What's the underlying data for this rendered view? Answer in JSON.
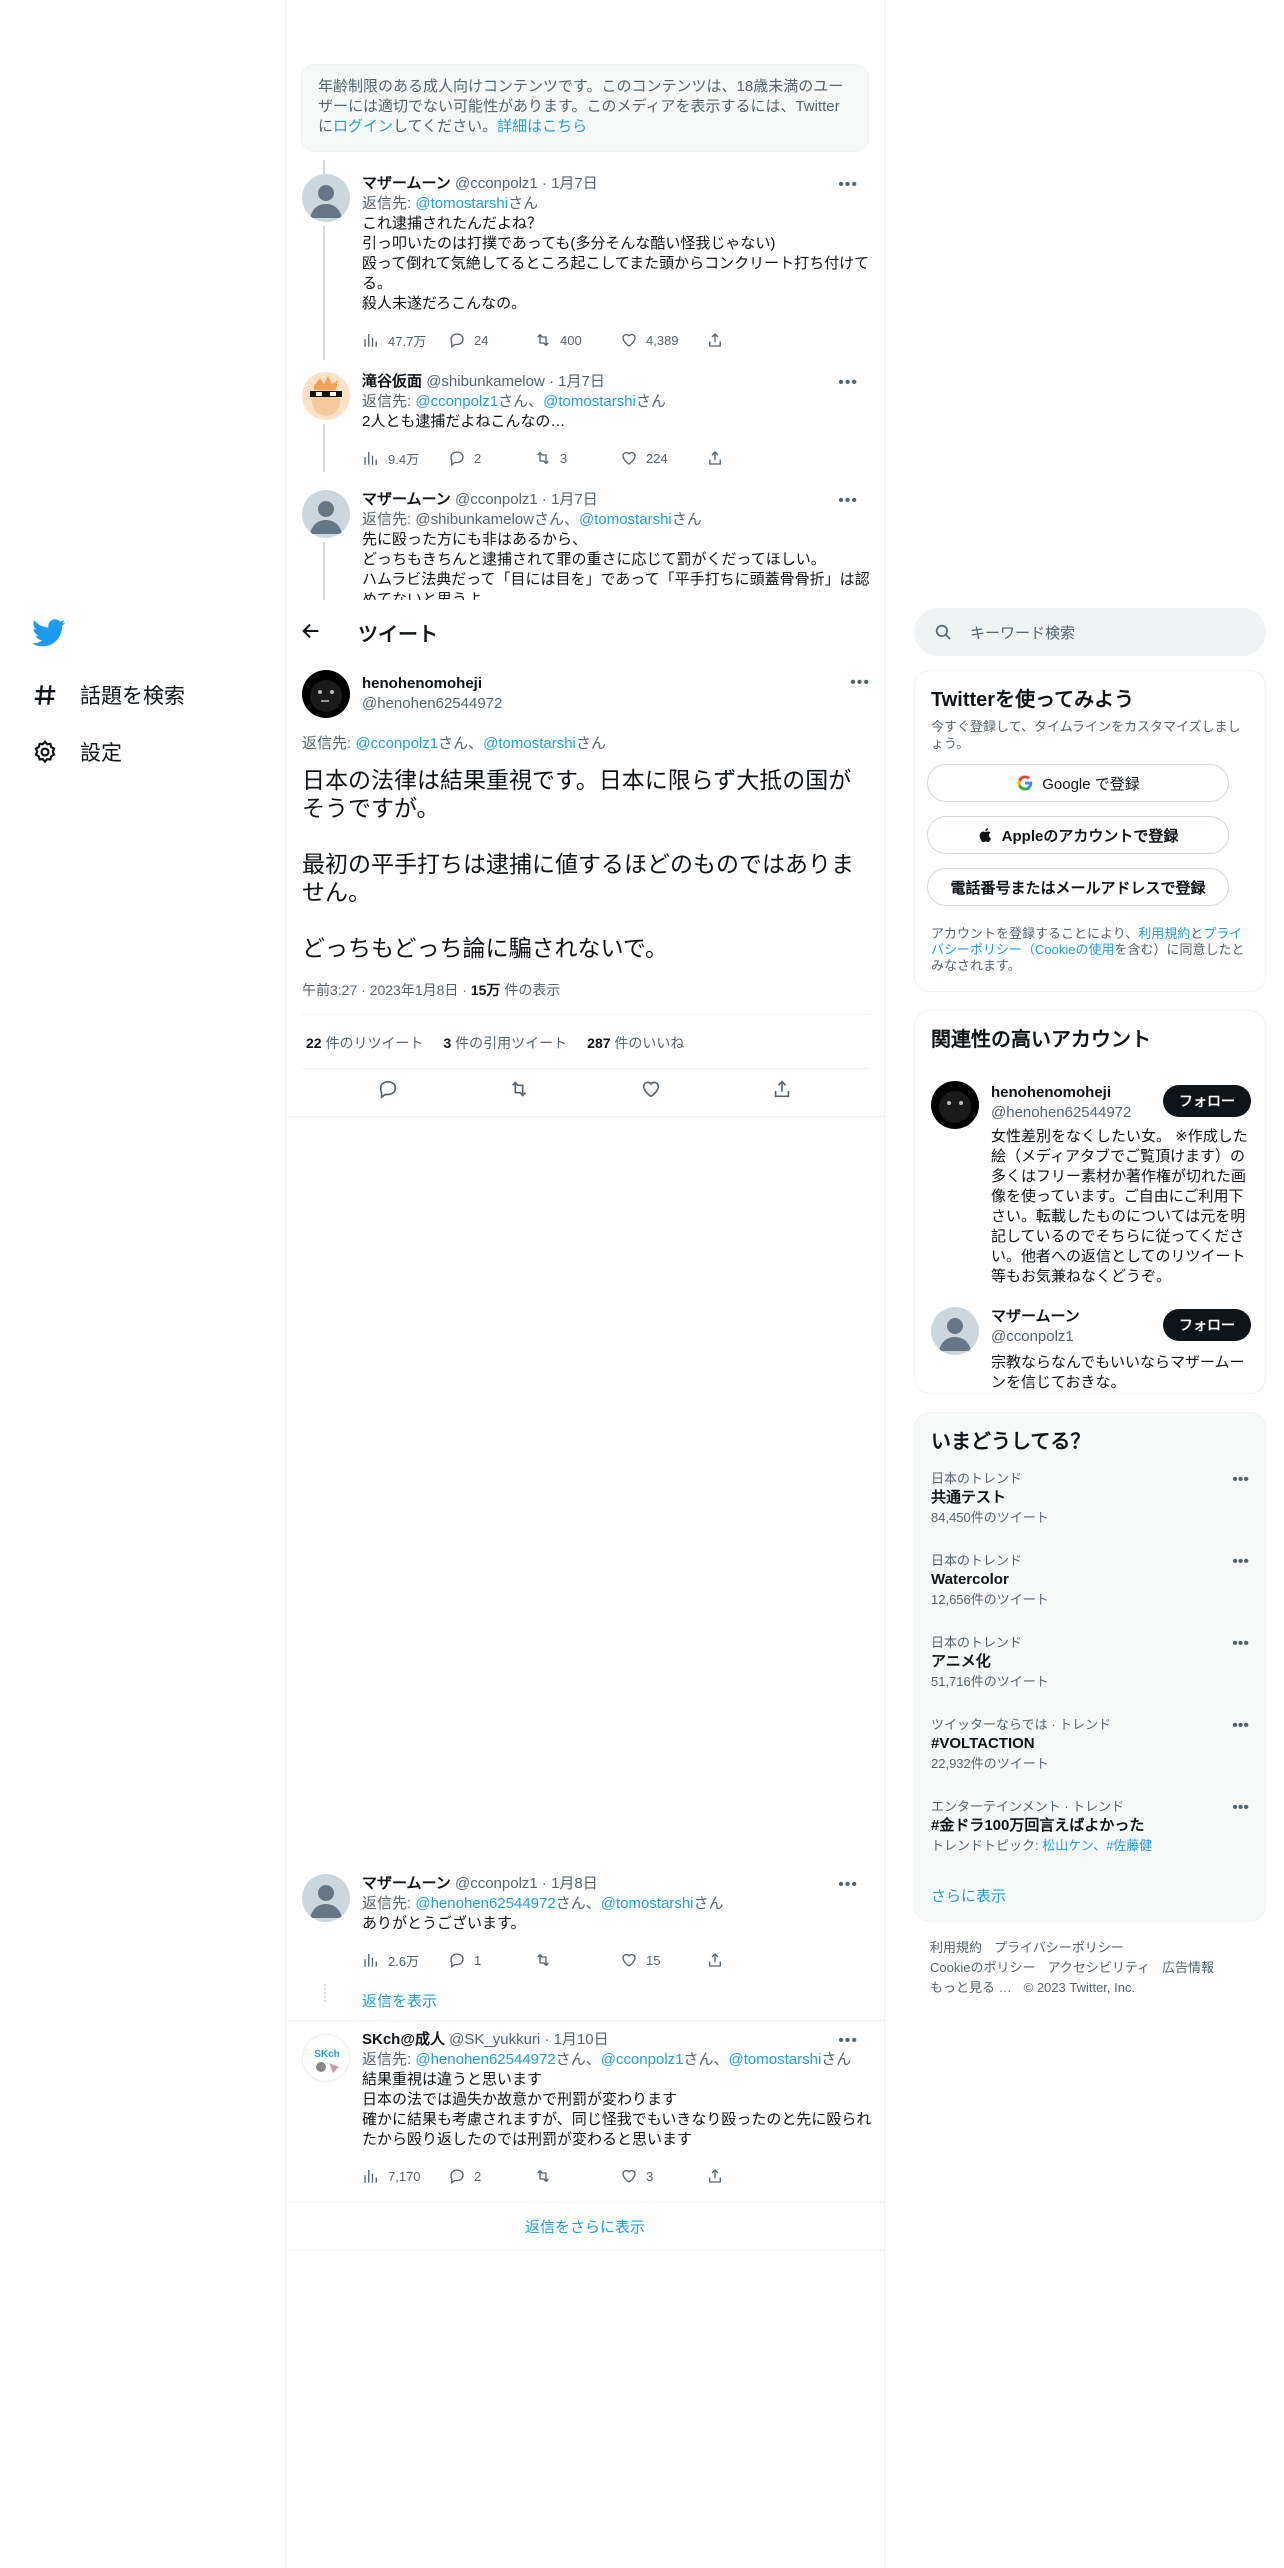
{
  "nav": {
    "explore": "話題を検索",
    "settings": "設定"
  },
  "warning": {
    "text1": "年齢制限のある成人向けコンテンツです。このコンテンツは、18歳未満のユーザーには適切でない可能性があります。このメディアを表示するには、Twitterに",
    "login": "ログイン",
    "text2": "してください。",
    "more": "詳細はこちら"
  },
  "tweets_above": [
    {
      "name": "マザームーン",
      "handle": "@cconpolz1 · 1月7日",
      "reply_prefix": "返信先: ",
      "reply_to": "@tomostarshi",
      "reply_suffix": "さん",
      "text": "これ逮捕されたんだよね？\n引っ叩いたのは打撲であっても(多分そんな酷い怪我じゃない)\n殴って倒れて気絶してるところ起こしてまた頭からコンクリート打ち付けてる。\n殺人未遂だろこんなの。",
      "views": "47.7万",
      "replies": "24",
      "retweets": "400",
      "likes": "4,389"
    },
    {
      "name": "滝谷仮面",
      "handle": "@shibunkamelow · 1月7日",
      "reply_prefix": "返信先: ",
      "reply_to": "@cconpolz1",
      "reply_mid": "さん、",
      "reply_to2": "@tomostarshi",
      "reply_suffix": "さん",
      "text": "2人とも逮捕だよねこんなの…",
      "views": "9.4万",
      "replies": "2",
      "retweets": "3",
      "likes": "224"
    },
    {
      "name": "マザームーン",
      "handle": "@cconpolz1 · 1月7日",
      "reply_prefix": "返信先: ",
      "reply_to": "@shibunkamelow",
      "reply_mid": "さん、",
      "reply_to2": "@tomostarshi",
      "reply_suffix": "さん",
      "text": "先に殴った方にも非はあるから、\nどっちもきちんと逮捕されて罪の重さに応じて罰がくだってほしい。\nハムラビ法典だって「目には目を」であって「平手打ちに頭蓋骨骨折」は認めてないと思うよ"
    }
  ],
  "header": {
    "title": "ツイート"
  },
  "main_tweet": {
    "name": "henohenomoheji",
    "handle": "@henohen62544972",
    "reply_prefix": "返信先: ",
    "reply_to": "@cconpolz1",
    "reply_mid": "さん、",
    "reply_to2": "@tomostarshi",
    "reply_suffix": "さん",
    "text": "日本の法律は結果重視です。日本に限らず大抵の国がそうですが。\n\n最初の平手打ちは逮捕に値するほどのものではありません。\n\nどっちもどっち論に騙されないで。",
    "time": "午前3:27 · 2023年1月8日 · ",
    "views": "15万",
    "views_suffix": " 件の表示",
    "retweets": "22",
    "retweets_label": " 件のリツイート",
    "quotes": "3",
    "quotes_label": " 件の引用ツイート",
    "likes": "287",
    "likes_label": " 件のいいね"
  },
  "replies": [
    {
      "name": "マザームーン",
      "handle": "@cconpolz1 · 1月8日",
      "reply_prefix": "返信先: ",
      "reply_to": "@henohen62544972",
      "reply_mid": "さん、",
      "reply_to2": "@tomostarshi",
      "reply_suffix": "さん",
      "text": "ありがとうございます。",
      "views": "2.6万",
      "replies": "1",
      "retweets": "",
      "likes": "15",
      "show_replies": "返信を表示"
    },
    {
      "name": "SKch@成人",
      "handle": "@SK_yukkuri · 1月10日",
      "reply_prefix": "返信先: ",
      "reply_to": "@henohen62544972",
      "reply_mid": "さん、",
      "reply_to2": "@cconpolz1",
      "reply_mid2": "さん、",
      "reply_to3": "@tomostarshi",
      "reply_suffix": "さん",
      "text": "結果重視は違うと思います\n日本の法では過失か故意かで刑罰が変わります\n確かに結果も考慮されますが、同じ怪我でもいきなり殴ったのと先に殴られたから殴り返したのでは刑罰が変わると思います",
      "views": "7,170",
      "replies": "2",
      "retweets": "",
      "likes": "3"
    }
  ],
  "more_replies": "返信をさらに表示",
  "search": {
    "placeholder": "キーワード検索"
  },
  "signup": {
    "title": "Twitterを使ってみよう",
    "sub": "今すぐ登録して、タイムラインをカスタマイズしましょう。",
    "google": "Google で登録",
    "apple": "Appleのアカウントで登録",
    "phone": "電話番号またはメールアドレスで登録",
    "legal1": "アカウントを登録することにより、",
    "terms": "利用規約",
    "and": "と",
    "privacy": "プライバシーポリシー（Cookieの使用",
    "legal2": "を含む）に同意したとみなされます。"
  },
  "related": {
    "title": "関連性の高いアカウント",
    "accounts": [
      {
        "name": "henohenomoheji",
        "handle": "@henohen62544972",
        "bio": "女性差別をなくしたい女。 ※作成した絵（メディアタブでご覧頂けます）の多くはフリー素材か著作権が切れた画像を使っています。ご自由にご利用下さい。転載したものについては元を明記しているのでそちらに従ってください。他者への返信としてのリツイート等もお気兼ねなくどうぞ。",
        "follow": "フォロー"
      },
      {
        "name": "マザームーン",
        "handle": "@cconpolz1",
        "bio": "宗教ならなんでもいいならマザームーンを信じておきな。",
        "follow": "フォロー"
      }
    ]
  },
  "trends": {
    "title": "いまどうしてる？",
    "items": [
      {
        "cat": "日本のトレンド",
        "name": "共通テスト",
        "count": "84,450件のツイート"
      },
      {
        "cat": "日本のトレンド",
        "name": "Watercolor",
        "count": "12,656件のツイート"
      },
      {
        "cat": "日本のトレンド",
        "name": "アニメ化",
        "count": "51,716件のツイート"
      },
      {
        "cat": "ツイッターならでは · トレンド",
        "name": "#VOLTACTION",
        "count": "22,932件のツイート"
      },
      {
        "cat": "エンターテインメント · トレンド",
        "name": "#金ドラ100万回言えばよかった",
        "count_prefix": "トレンドトピック: ",
        "count": "松山ケン、#佐藤健"
      }
    ],
    "more": "さらに表示"
  },
  "footer": {
    "links": [
      "利用規約",
      "プライバシーポリシー",
      "Cookieのポリシー",
      "アクセシビリティ",
      "広告情報",
      "もっと見る …"
    ],
    "copyright": "© 2023 Twitter, Inc."
  }
}
